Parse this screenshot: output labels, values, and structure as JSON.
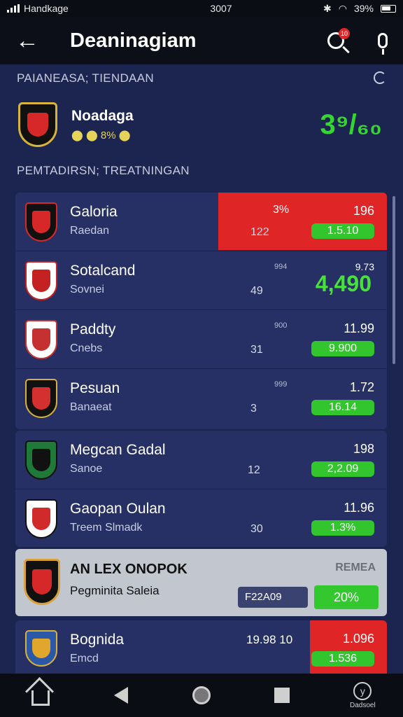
{
  "status_bar": {
    "carrier": "Handkage",
    "time": "3007",
    "battery": "39%"
  },
  "header": {
    "title": "Deaninagiam",
    "search_badge": "10"
  },
  "featured_section": {
    "label": "PAIANEASA; TIENDAAN",
    "team": "Noadaga",
    "sub": "⬤ ⬤ 8% ⬤",
    "score": "3⁹/₆₀"
  },
  "list_section": {
    "label": "PEMTADIRSN; TREATNINGAN"
  },
  "rows": [
    {
      "name": "Galoria",
      "sub": "Raedan",
      "mid": "122",
      "small": "3%",
      "value": "196",
      "pill": "1.5.10",
      "colors": [
        "#d52a2a",
        "#111111"
      ]
    },
    {
      "name": "Sotalcand",
      "sub": "Sovnei",
      "mid": "49",
      "small": "994",
      "value": "9.73",
      "big": "4,490",
      "colors": [
        "#c42222",
        "#ffffff"
      ]
    },
    {
      "name": "Paddty",
      "sub": "Cnebs",
      "mid": "31",
      "small": "900",
      "value": "11.99",
      "pill": "9.900",
      "colors": [
        "#c53131",
        "#ffffff"
      ]
    },
    {
      "name": "Pesuan",
      "sub": "Banaeat",
      "mid": "3",
      "small": "999",
      "value": "1.72",
      "pill": "16.14",
      "colors": [
        "#111111",
        "#d53030"
      ]
    }
  ],
  "rows2": [
    {
      "name": "Megcan Gadal",
      "sub": "Sanoe",
      "mid": "12",
      "value": "198",
      "pill": "2,2.09",
      "colors": [
        "#1f7a3a",
        "#111111"
      ]
    },
    {
      "name": "Gaopan Oulan",
      "sub": "Treem Slmadk",
      "mid": "30",
      "value": "11.96",
      "pill": "1.3%",
      "colors": [
        "#ffffff",
        "#d12a2a"
      ]
    }
  ],
  "promo": {
    "title": "AN LEX ONOPOK",
    "sub": "Pegminita Saleia",
    "tag": "REMEA",
    "chip": "F22A09",
    "pill": "20%"
  },
  "last_row": {
    "name": "Bognida",
    "sub": "Emcd",
    "mid": "19.98 10",
    "value": "1.096",
    "pill": "1.536"
  },
  "nav": {
    "last_label": "Dadsoel"
  }
}
